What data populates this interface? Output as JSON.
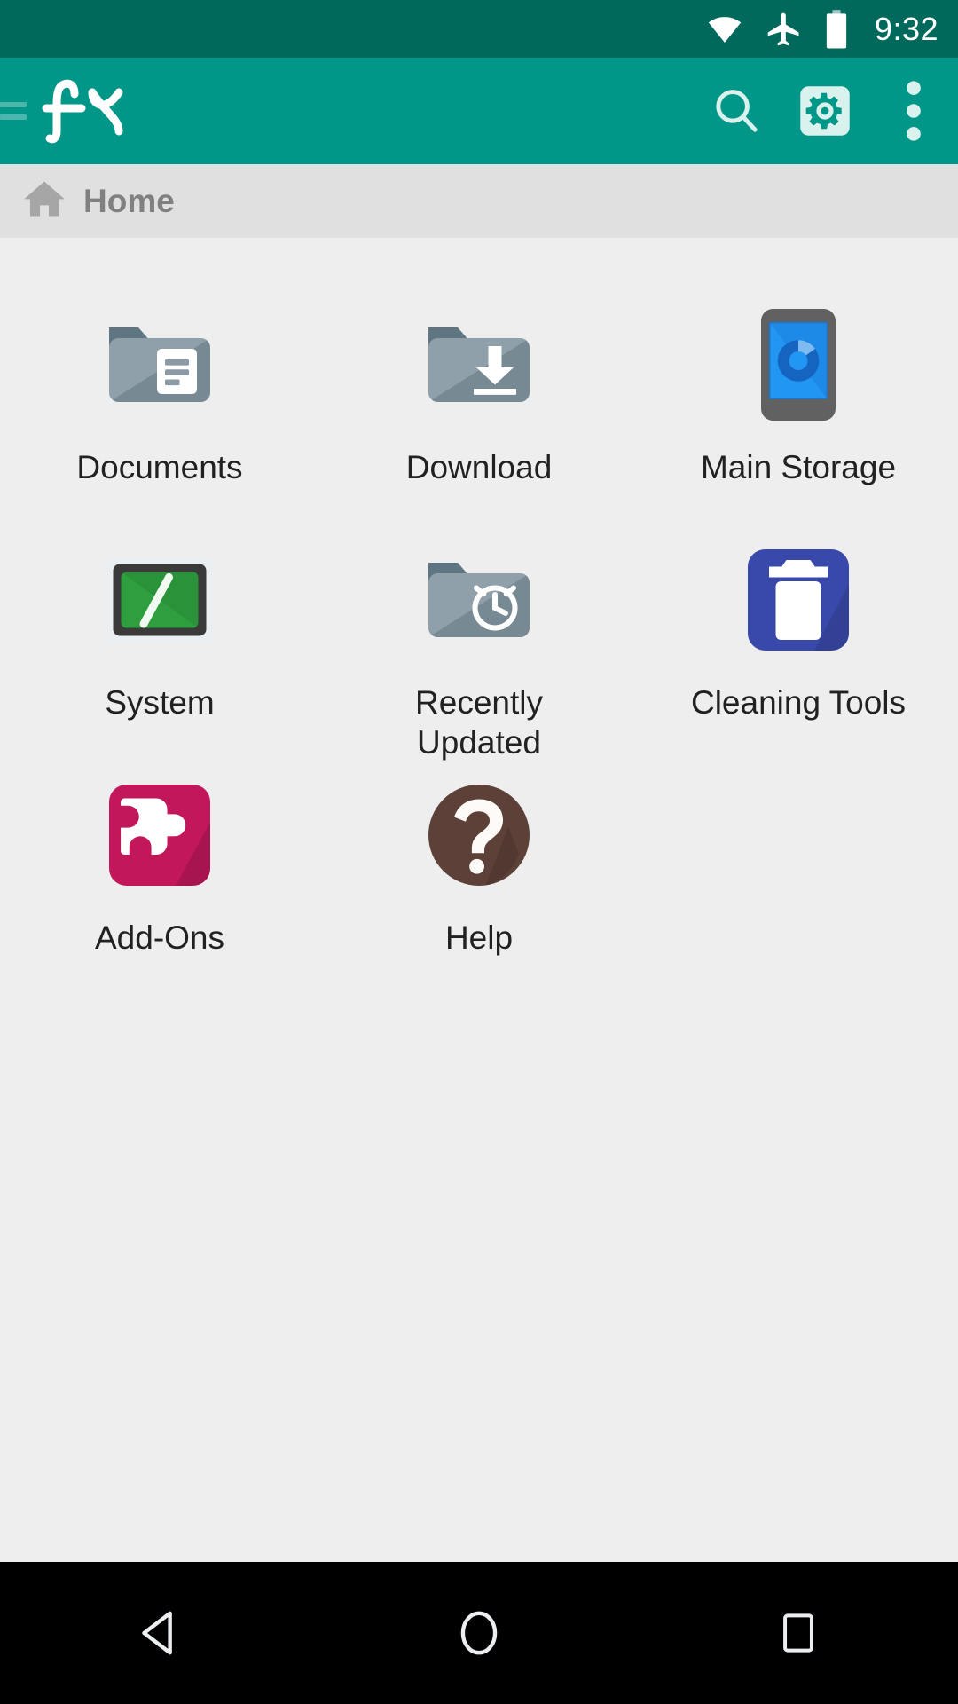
{
  "status_bar": {
    "time": "9:32",
    "icons": [
      "wifi-icon",
      "airplane-mode-icon",
      "battery-full-icon"
    ],
    "background_color": "#00695c"
  },
  "app_bar": {
    "logo_text": "fX",
    "drawer_icon": "hamburger-peek-icon",
    "background_color": "#009688",
    "actions": [
      {
        "name": "search",
        "label": "Search",
        "icon": "search-icon"
      },
      {
        "name": "settings",
        "label": "Settings",
        "icon": "gear-icon"
      },
      {
        "name": "overflow",
        "label": "More options",
        "icon": "overflow-menu-icon"
      }
    ]
  },
  "breadcrumb": {
    "icon": "home-icon",
    "label": "Home",
    "background_color": "#e0e0e0",
    "text_color": "#808080"
  },
  "main": {
    "background_color": "#eeeeee",
    "items": [
      {
        "label": "Documents",
        "icon": "folder-documents-icon",
        "color": "#7d8f9b"
      },
      {
        "label": "Download",
        "icon": "folder-download-icon",
        "color": "#7d8f9b"
      },
      {
        "label": "Main Storage",
        "icon": "device-storage-icon",
        "color": "#2196f3"
      },
      {
        "label": "System",
        "icon": "terminal-root-icon",
        "color": "#2e9e3e"
      },
      {
        "label": "Recently Updated",
        "icon": "folder-clock-icon",
        "color": "#7d8f9b"
      },
      {
        "label": "Cleaning Tools",
        "icon": "trash-can-icon",
        "color": "#3949ab"
      },
      {
        "label": "Add-Ons",
        "icon": "puzzle-piece-icon",
        "color": "#c2185b"
      },
      {
        "label": "Help",
        "icon": "question-mark-icon",
        "color": "#5d4037"
      }
    ]
  },
  "nav_bar": {
    "background_color": "#000000",
    "buttons": [
      {
        "name": "back",
        "label": "Back",
        "icon": "back-triangle-icon"
      },
      {
        "name": "home",
        "label": "Home",
        "icon": "home-circle-icon"
      },
      {
        "name": "recents",
        "label": "Recents",
        "icon": "recents-square-icon"
      }
    ]
  }
}
